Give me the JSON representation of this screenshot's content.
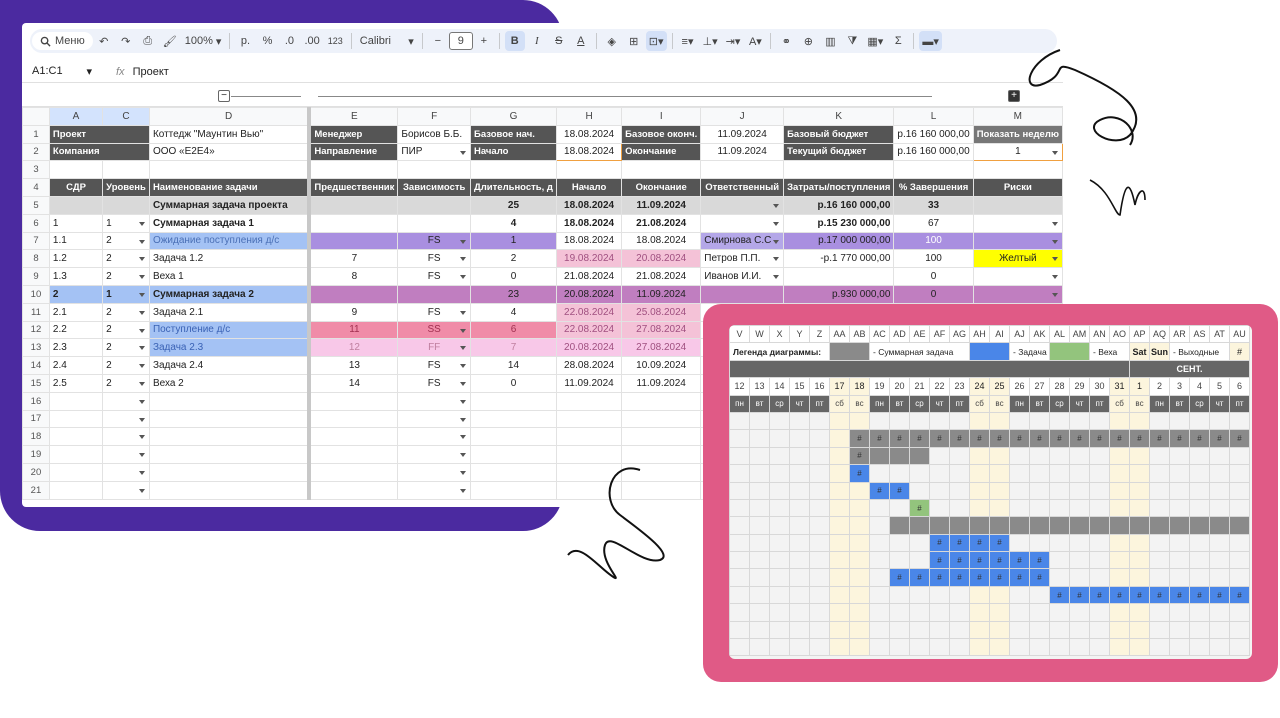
{
  "toolbar": {
    "menu_label": "Меню",
    "zoom": "100%",
    "currency": "р.",
    "percent": "%",
    "dec_decrease": ".0",
    "dec_increase": ".00",
    "number_format": "123",
    "font": "Calibri",
    "font_size": "9",
    "bold": "B",
    "italic": "I",
    "strike": "S",
    "text_color": "A",
    "sum": "Σ"
  },
  "formula_bar": {
    "cell_ref": "A1:C1",
    "fx": "fx",
    "value": "Проект"
  },
  "columns": [
    "A",
    "C",
    "D",
    "E",
    "F",
    "G",
    "H",
    "I",
    "J",
    "K",
    "L",
    "M"
  ],
  "project": {
    "r1": [
      "Проект",
      "Коттедж \"Маунтин Вью\"",
      "Менеджер",
      "Борисов Б.Б.",
      "Базовое нач.",
      "18.08.2024",
      "Базовое оконч.",
      "11.09.2024",
      "Базовый бюджет",
      "р.16 160 000,00",
      "Показать неделю"
    ],
    "r2": [
      "Компания",
      "ООО «E2E4»",
      "Направление",
      "ПИР",
      "Начало",
      "18.08.2024",
      "Окончание",
      "11.09.2024",
      "Текущий бюджет",
      "р.16 160 000,00",
      "1"
    ]
  },
  "headers": [
    "СДР",
    "Уровень",
    "Наименование задачи",
    "Предшественник",
    "Зависимость",
    "Длительность, д",
    "Начало",
    "Окончание",
    "Ответственный",
    "Затраты/поступления",
    "% Завершения",
    "Риски"
  ],
  "rows": [
    {
      "n": "5",
      "a": "",
      "c": "",
      "d": "Суммарная задача проекта",
      "e": "",
      "f": "",
      "g": "25",
      "h": "18.08.2024",
      "i": "11.09.2024",
      "j": "",
      "k": "р.16 160 000,00",
      "l": "33",
      "m": ""
    },
    {
      "n": "6",
      "a": "1",
      "c": "1",
      "d": "Суммарная задача 1",
      "e": "",
      "f": "",
      "g": "4",
      "h": "18.08.2024",
      "i": "21.08.2024",
      "j": "",
      "k": "р.15 230 000,00",
      "l": "67",
      "m": ""
    },
    {
      "n": "7",
      "a": "1.1",
      "c": "2",
      "d": "Ожидание поступления д/с",
      "e": "",
      "f": "FS",
      "g": "1",
      "h": "18.08.2024",
      "i": "18.08.2024",
      "j": "Смирнова С.С",
      "k": "р.17 000 000,00",
      "l": "100",
      "m": ""
    },
    {
      "n": "8",
      "a": "1.2",
      "c": "2",
      "d": "Задача 1.2",
      "e": "7",
      "f": "FS",
      "g": "2",
      "h": "19.08.2024",
      "i": "20.08.2024",
      "j": "Петров П.П.",
      "k": "-р.1 770 000,00",
      "l": "100",
      "m": "Желтый"
    },
    {
      "n": "9",
      "a": "1.3",
      "c": "2",
      "d": "Веха 1",
      "e": "8",
      "f": "FS",
      "g": "0",
      "h": "21.08.2024",
      "i": "21.08.2024",
      "j": "Иванов И.И.",
      "k": "",
      "l": "0",
      "m": ""
    },
    {
      "n": "10",
      "a": "2",
      "c": "1",
      "d": "Суммарная задача 2",
      "e": "",
      "f": "",
      "g": "23",
      "h": "20.08.2024",
      "i": "11.09.2024",
      "j": "",
      "k": "р.930 000,00",
      "l": "0",
      "m": ""
    },
    {
      "n": "11",
      "a": "2.1",
      "c": "2",
      "d": "Задача 2.1",
      "e": "9",
      "f": "FS",
      "g": "4",
      "h": "22.08.2024",
      "i": "25.08.2024",
      "j": "",
      "k": "",
      "l": "",
      "m": ""
    },
    {
      "n": "12",
      "a": "2.2",
      "c": "2",
      "d": "Поступление д/с",
      "e": "11",
      "f": "SS",
      "g": "6",
      "h": "22.08.2024",
      "i": "27.08.2024",
      "j": "",
      "k": "",
      "l": "",
      "m": ""
    },
    {
      "n": "13",
      "a": "2.3",
      "c": "2",
      "d": "Задача 2.3",
      "e": "12",
      "f": "FF",
      "g": "7",
      "h": "20.08.2024",
      "i": "27.08.2024",
      "j": "",
      "k": "",
      "l": "",
      "m": ""
    },
    {
      "n": "14",
      "a": "2.4",
      "c": "2",
      "d": "Задача 2.4",
      "e": "13",
      "f": "FS",
      "g": "14",
      "h": "28.08.2024",
      "i": "10.09.2024",
      "j": "",
      "k": "",
      "l": "",
      "m": ""
    },
    {
      "n": "15",
      "a": "2.5",
      "c": "2",
      "d": "Веха 2",
      "e": "14",
      "f": "FS",
      "g": "0",
      "h": "11.09.2024",
      "i": "11.09.2024",
      "j": "",
      "k": "",
      "l": "",
      "m": ""
    }
  ],
  "empty_rows": [
    "16",
    "17",
    "18",
    "19",
    "20",
    "21"
  ],
  "gantt": {
    "cols": [
      "V",
      "W",
      "X",
      "Y",
      "Z",
      "AA",
      "AB",
      "AC",
      "AD",
      "AE",
      "AF",
      "AG",
      "AH",
      "AI",
      "AJ",
      "AK",
      "AL",
      "AM",
      "AN",
      "AO",
      "AP",
      "AQ",
      "AR",
      "AS",
      "AT",
      "AU"
    ],
    "legend_title": "Легенда диаграммы:",
    "legend_summary": "- Суммарная задача",
    "legend_task": "- Задача",
    "legend_milestone": "- Веха",
    "legend_sat": "Sat",
    "legend_sun": "Sun",
    "legend_weekend": "- Выходные",
    "legend_hash": "#",
    "month": "СЕНТ.",
    "days": [
      "12",
      "13",
      "14",
      "15",
      "16",
      "17",
      "18",
      "19",
      "20",
      "21",
      "22",
      "23",
      "24",
      "25",
      "26",
      "27",
      "28",
      "29",
      "30",
      "31",
      "1",
      "2",
      "3",
      "4",
      "5",
      "6"
    ],
    "weekdays": [
      "пн",
      "вт",
      "ср",
      "чт",
      "пт",
      "сб",
      "вс",
      "пн",
      "вт",
      "ср",
      "чт",
      "пт",
      "сб",
      "вс",
      "пн",
      "вт",
      "ср",
      "чт",
      "пт",
      "сб",
      "вс",
      "пн",
      "вт",
      "ср",
      "чт",
      "пт"
    ],
    "hash": "#"
  },
  "colors": {
    "purple": "#4b2aa0",
    "pink": "#e05a86",
    "blue": "#4a86e8",
    "grey": "#8a8a8a",
    "green": "#93c47d",
    "yellow": "#ffff00"
  }
}
